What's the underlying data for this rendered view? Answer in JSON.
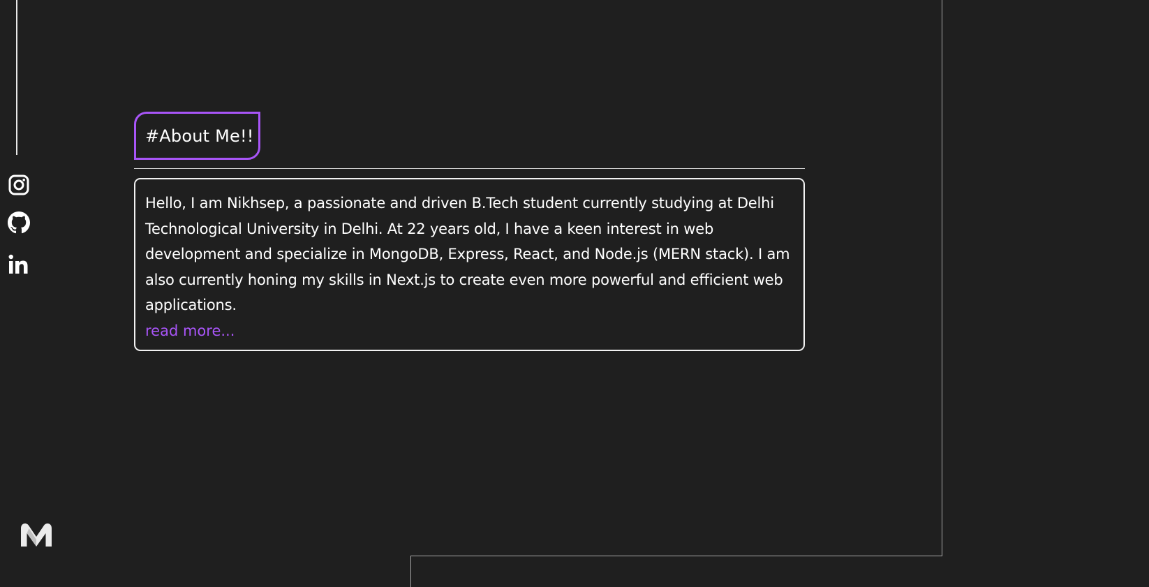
{
  "social": {
    "instagram_label": "Instagram",
    "github_label": "GitHub",
    "linkedin_label": "LinkedIn"
  },
  "about": {
    "heading": "#About Me!!",
    "body": "Hello, I am Nikhsep, a passionate and driven B.Tech student currently studying at Delhi Technological University in Delhi. At 22 years old, I have a keen interest in web development and specialize in MongoDB, Express, React, and Node.js (MERN stack). I am also currently honing my skills in Next.js to create even more powerful and efficient web applications.",
    "read_more": "read more..."
  },
  "colors": {
    "background": "#1f1f1f",
    "accent": "#a855f7",
    "text": "#ffffff",
    "border": "#f2f2f2"
  },
  "icons": [
    "instagram-icon",
    "github-icon",
    "linkedin-icon",
    "m-logo-icon"
  ]
}
